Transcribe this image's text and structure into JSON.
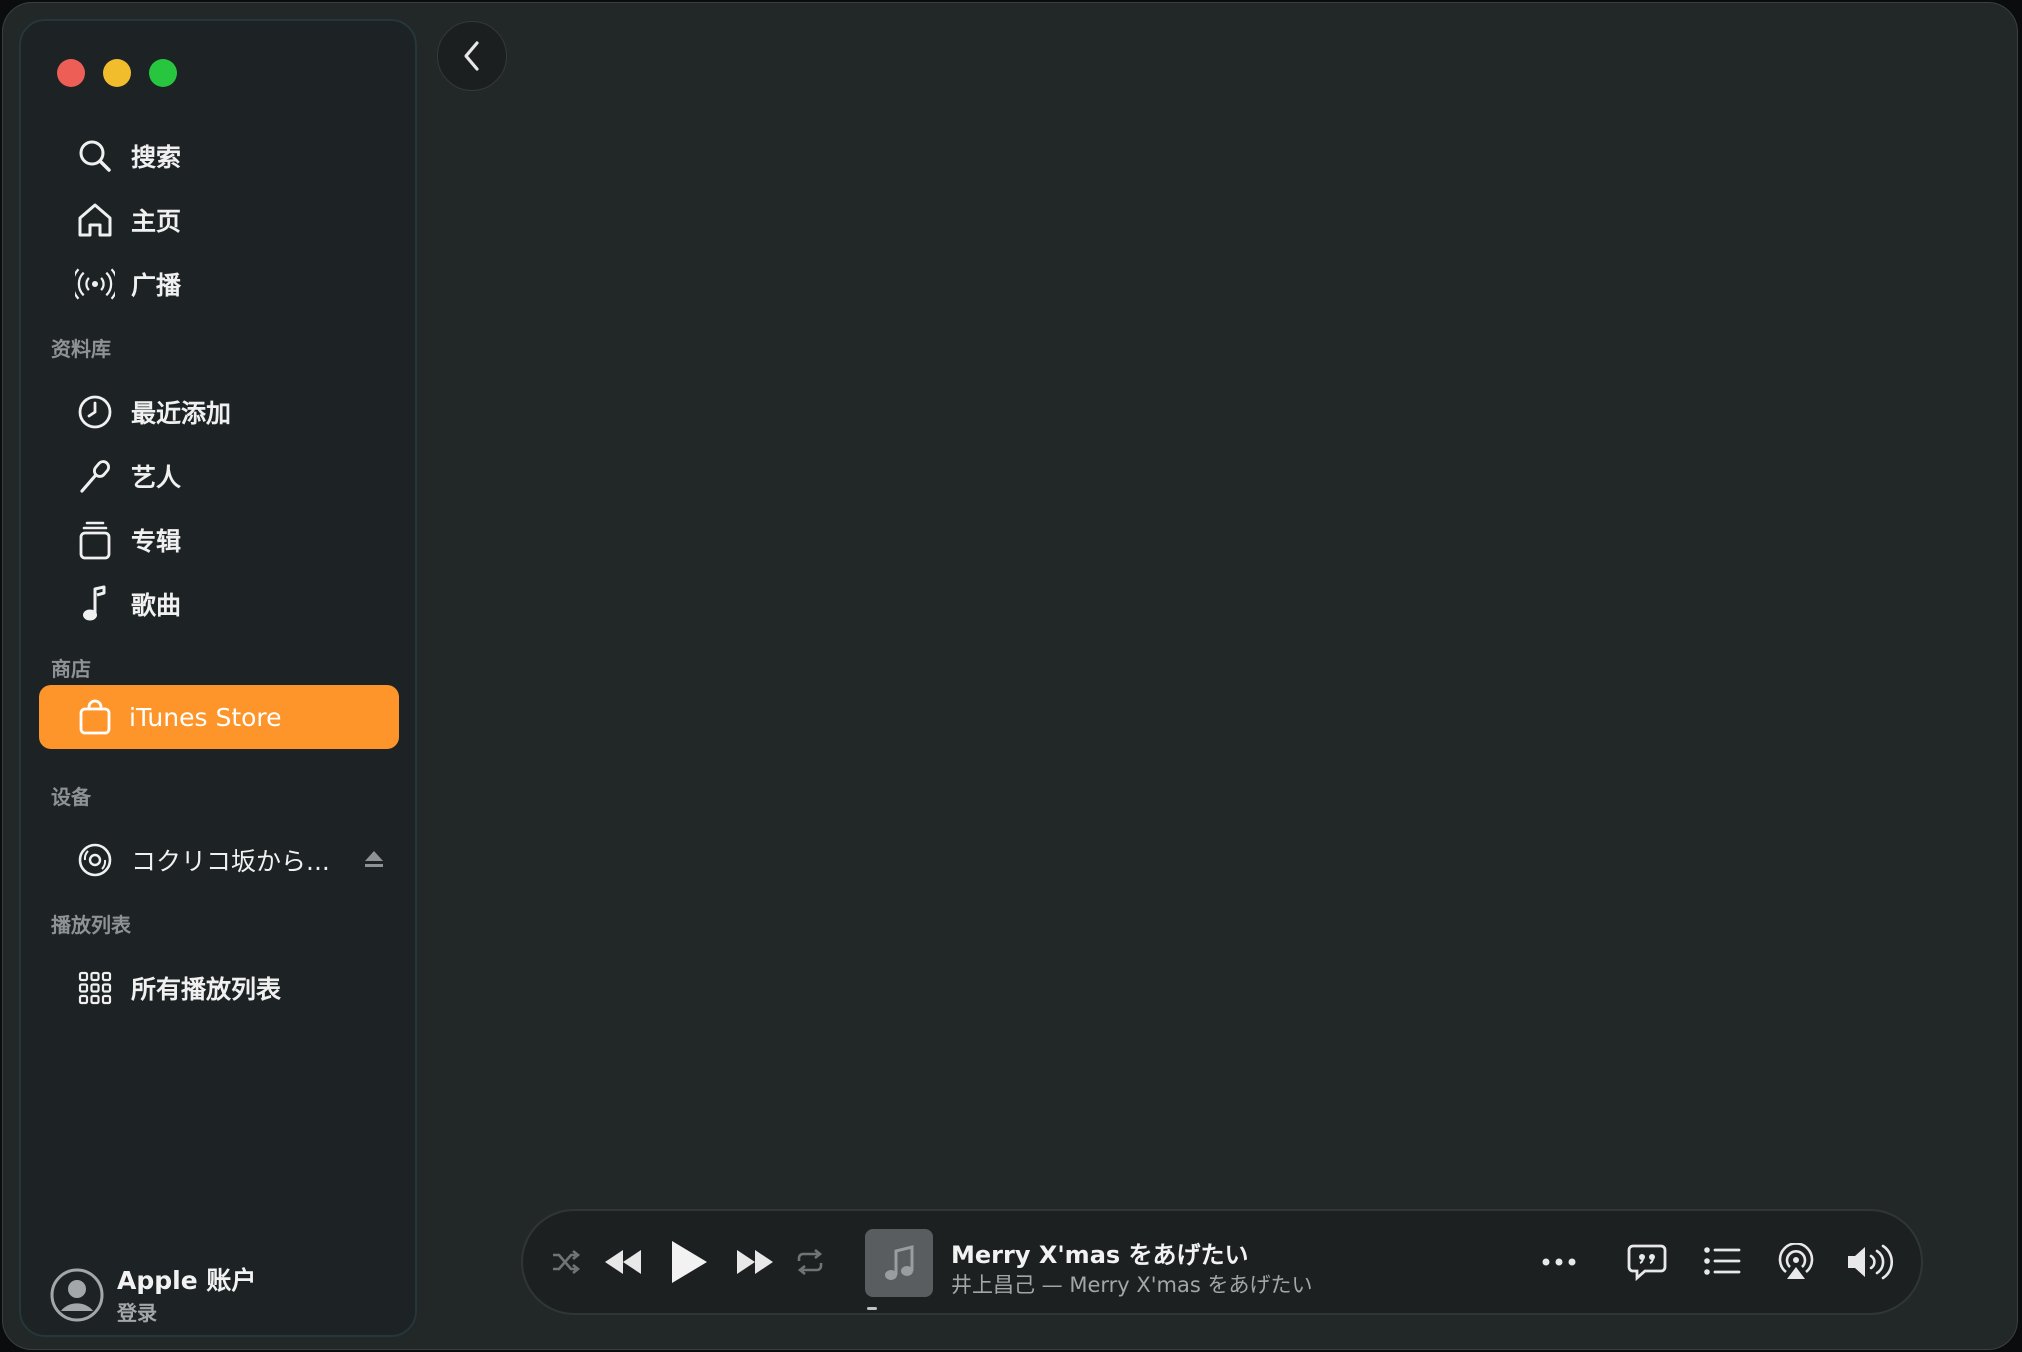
{
  "sidebar": {
    "top_items": [
      {
        "label": "搜索",
        "icon": "search-icon"
      },
      {
        "label": "主页",
        "icon": "home-icon"
      },
      {
        "label": "广播",
        "icon": "broadcast-icon"
      }
    ],
    "library": {
      "heading": "资料库",
      "items": [
        {
          "label": "最近添加",
          "icon": "clock-icon"
        },
        {
          "label": "艺人",
          "icon": "microphone-icon"
        },
        {
          "label": "专辑",
          "icon": "album-stack-icon"
        },
        {
          "label": "歌曲",
          "icon": "music-note-icon"
        }
      ]
    },
    "store": {
      "heading": "商店",
      "items": [
        {
          "label": "iTunes Store",
          "icon": "shopping-bag-icon",
          "active": true
        }
      ]
    },
    "devices": {
      "heading": "设备",
      "items": [
        {
          "label": "コクリコ坂から...",
          "icon": "cd-icon"
        }
      ]
    },
    "playlists": {
      "heading": "播放列表",
      "items": [
        {
          "label": "所有播放列表",
          "icon": "grid-icon"
        }
      ]
    },
    "account": {
      "name": "Apple 账户",
      "sub": "登录"
    }
  },
  "player": {
    "title": "Merry X'mas をあげたい",
    "subtitle": "井上昌己 — Merry X'mas をあげたい",
    "progress": 0.0
  },
  "colors": {
    "accent": "#fe952b",
    "window_bg": "#222728",
    "sidebar_bg": "#1d2325"
  }
}
